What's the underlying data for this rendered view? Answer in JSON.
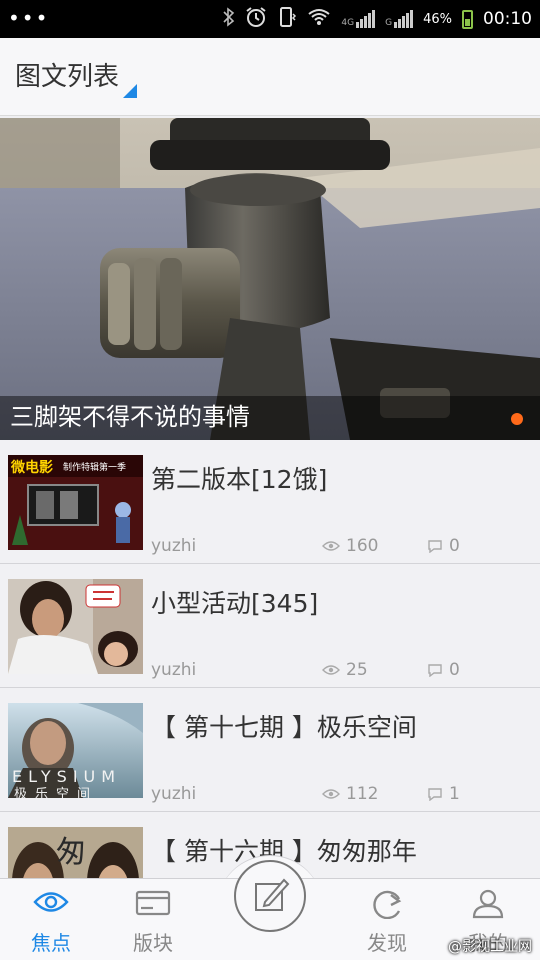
{
  "status_bar": {
    "battery_pct": "46%",
    "time": "00:10",
    "network_4g": "4G",
    "network_g": "G",
    "icons": [
      "bluetooth-icon",
      "alarm-icon",
      "vibrate-icon",
      "wifi-icon",
      "signal-icon",
      "battery-icon"
    ]
  },
  "header": {
    "title": "图文列表",
    "accent_color": "#1e88e5"
  },
  "banner": {
    "caption": "三脚架不得不说的事情",
    "indicator_color": "#ff6a1a"
  },
  "articles": [
    {
      "title": "第二版本[12饿]",
      "author": "yuzhi",
      "views": "160",
      "comments": "0",
      "thumb_text": "微电影",
      "thumb_subtext": "制作特辑第一季"
    },
    {
      "title": "小型活动[345]",
      "author": "yuzhi",
      "views": "25",
      "comments": "0",
      "thumb_text": "",
      "thumb_subtext": ""
    },
    {
      "title": "【 第十七期 】极乐空间",
      "author": "yuzhi",
      "views": "112",
      "comments": "1",
      "thumb_text": "ELYSIUM",
      "thumb_subtext": "极乐空间"
    },
    {
      "title": "【 第十六期 】匆匆那年",
      "author": "",
      "views": "",
      "comments": "",
      "thumb_text": "匆",
      "thumb_subtext": ""
    }
  ],
  "tabbar": {
    "tabs": [
      {
        "label": "焦点",
        "icon": "eye-icon",
        "active": true
      },
      {
        "label": "版块",
        "icon": "card-icon",
        "active": false
      },
      {
        "label": "发现",
        "icon": "discover-icon",
        "active": false
      },
      {
        "label": "我的",
        "icon": "user-icon",
        "active": false
      }
    ],
    "compose_icon": "compose-icon",
    "active_color": "#1e88e5"
  },
  "watermark": "@影视工业网"
}
